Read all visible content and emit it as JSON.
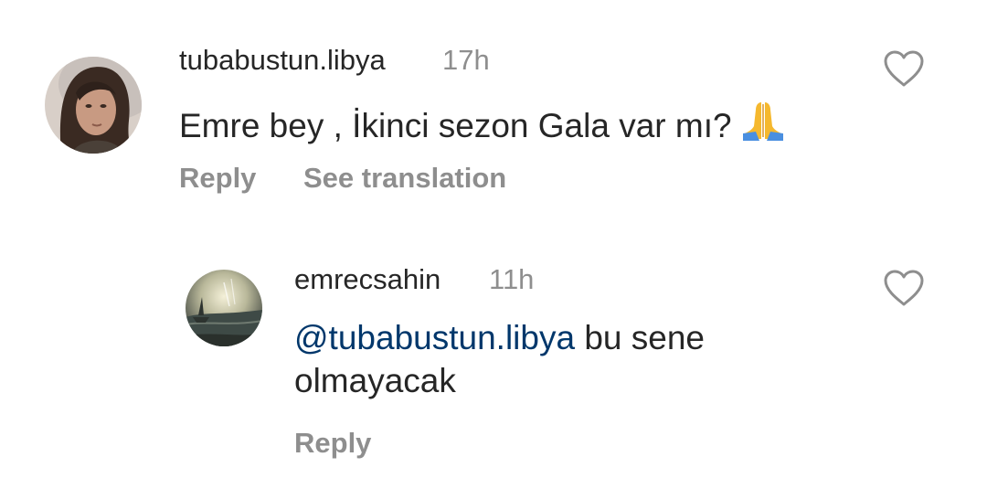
{
  "comments": [
    {
      "username": "tubabustun.libya",
      "time": "17h",
      "text": "Emre bey , İkinci sezon Gala var mı? ",
      "emoji": "folded-hands-emoji",
      "actions": {
        "reply": "Reply",
        "translate": "See translation"
      }
    },
    {
      "username": "emrecsahin",
      "time": "11h",
      "mention": "@tubabustun.libya",
      "text_line1": " bu sene",
      "text_line2": "olmayacak",
      "actions": {
        "reply": "Reply"
      }
    }
  ],
  "icons": {
    "like": "heart-outline-icon"
  },
  "colors": {
    "username": "#262626",
    "meta": "#8e8e8e",
    "mention": "#00376b",
    "heart": "#8e8e8e"
  }
}
